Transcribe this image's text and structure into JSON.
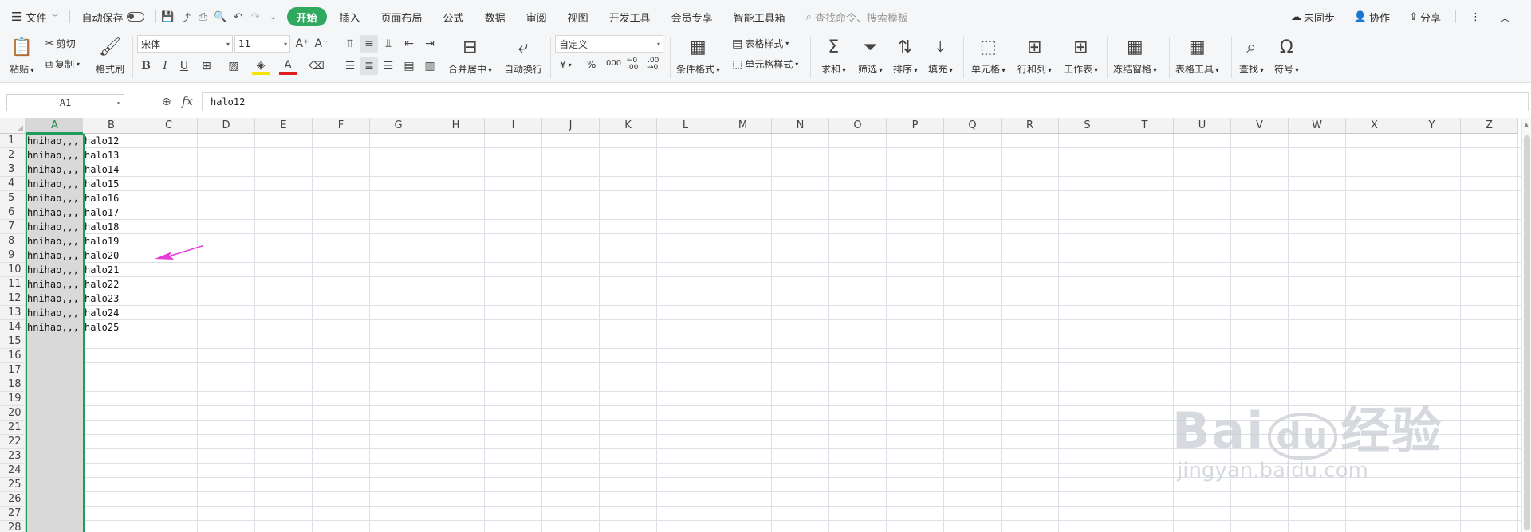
{
  "menu": {
    "file": "文件",
    "autosave": "自动保存",
    "tabs": [
      "开始",
      "插入",
      "页面布局",
      "公式",
      "数据",
      "审阅",
      "视图",
      "开发工具",
      "会员专享",
      "智能工具箱"
    ],
    "search_placeholder": "查找命令、搜索模板",
    "right": {
      "sync": "未同步",
      "collab": "协作",
      "share": "分享"
    }
  },
  "ribbon": {
    "paste": "粘贴",
    "cut": "剪切",
    "copy": "复制",
    "format_painter": "格式刷",
    "font_name": "宋体",
    "font_size": "11",
    "merge_center": "合并居中",
    "wrap_text": "自动换行",
    "number_format": "自定义",
    "currency": "¥",
    "percent": "%",
    "thousands": "000",
    "cond_format": "条件格式",
    "table_style": "表格样式",
    "cell_style": "单元格样式",
    "sum": "求和",
    "filter": "筛选",
    "sort": "排序",
    "fill": "填充",
    "cell": "单元格",
    "row_col": "行和列",
    "worksheet": "工作表",
    "freeze": "冻结窗格",
    "table_tools": "表格工具",
    "find": "查找",
    "symbol": "符号"
  },
  "formula_bar": {
    "name_box": "A1",
    "fx": "fx",
    "content": "halo12"
  },
  "sheet": {
    "columns": [
      "A",
      "B",
      "C",
      "D",
      "E",
      "F",
      "G",
      "H",
      "I",
      "J",
      "K",
      "L",
      "M",
      "N",
      "O",
      "P",
      "Q",
      "R",
      "S",
      "T",
      "U",
      "V",
      "W",
      "X",
      "Y",
      "Z"
    ],
    "rows": [
      "1",
      "2",
      "3",
      "4",
      "5",
      "6",
      "7",
      "8",
      "9",
      "10",
      "11",
      "12",
      "13",
      "14",
      "15",
      "16",
      "17",
      "18",
      "19",
      "20",
      "21",
      "22",
      "23",
      "24",
      "25",
      "26",
      "27",
      "28"
    ],
    "colA": [
      "hnihao,,,",
      "hnihao,,,",
      "hnihao,,,",
      "hnihao,,,",
      "hnihao,,,",
      "hnihao,,,",
      "hnihao,,,",
      "hnihao,,,",
      "hnihao,,,",
      "hnihao,,,",
      "hnihao,,,",
      "hnihao,,,",
      "hnihao,,,",
      "hnihao,,,"
    ],
    "colB": [
      "halo12",
      "halo13",
      "halo14",
      "halo15",
      "halo16",
      "halo17",
      "halo18",
      "halo19",
      "halo20",
      "halo21",
      "halo22",
      "halo23",
      "halo24",
      "halo25"
    ],
    "selected_column": "A",
    "annotation_arrow_color": "#e83ad8",
    "accent_color": "#1e9c5c"
  },
  "watermark": {
    "line1": "Bai 经验",
    "line2": "jingyan.baidu.com"
  }
}
